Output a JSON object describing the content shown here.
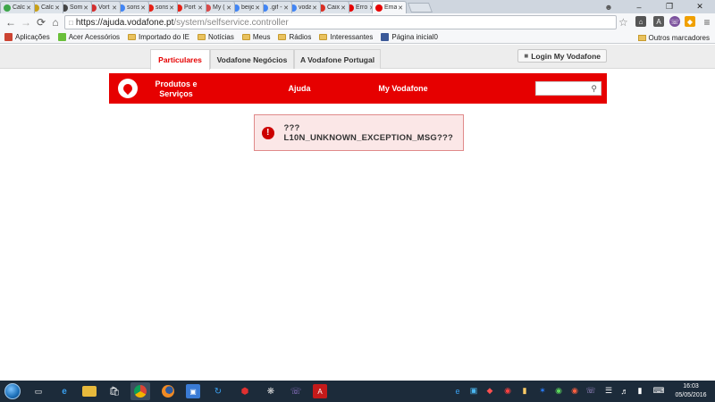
{
  "browser": {
    "tabs": [
      {
        "title": "Calcı",
        "favicon": "green-search-favicon",
        "color": "#3ea64a"
      },
      {
        "title": "Calcı",
        "favicon": "sapo-favicon",
        "color": "#c8a018"
      },
      {
        "title": "Som",
        "favicon": "help-favicon",
        "color": "#444444"
      },
      {
        "title": "Vort",
        "favicon": "y-favicon",
        "color": "#d32f2f"
      },
      {
        "title": "sons",
        "favicon": "google-favicon",
        "color": "#4285f4"
      },
      {
        "title": "sons",
        "favicon": "youtube-favicon",
        "color": "#e62117"
      },
      {
        "title": "Port",
        "favicon": "youtube-favicon",
        "color": "#e62117"
      },
      {
        "title": "My (",
        "favicon": "box-favicon",
        "color": "#d84a4a"
      },
      {
        "title": "beijo",
        "favicon": "google-favicon",
        "color": "#4285f4"
      },
      {
        "title": ".gif -",
        "favicon": "google-favicon",
        "color": "#4285f4"
      },
      {
        "title": "voda",
        "favicon": "google-favicon",
        "color": "#4285f4"
      },
      {
        "title": "Caixa",
        "favicon": "gmail-favicon",
        "color": "#d93025"
      },
      {
        "title": "Erro",
        "favicon": "vodafone-favicon",
        "color": "#e60000"
      },
      {
        "title": "Emai",
        "favicon": "vodafone-favicon",
        "color": "#e60000"
      }
    ],
    "url": {
      "host": "https://ajuda.vodafone.pt",
      "path": "/system/selfservice.controller"
    },
    "bookmarks": [
      {
        "label": "Aplicações",
        "icon": "apps-icon"
      },
      {
        "label": "Acer Acessórios",
        "icon": "acer-icon"
      },
      {
        "label": "Importado do IE",
        "icon": "folder-icon"
      },
      {
        "label": "Notícias",
        "icon": "folder-icon"
      },
      {
        "label": "Meus",
        "icon": "folder-icon"
      },
      {
        "label": "Rádios",
        "icon": "folder-icon"
      },
      {
        "label": "Interessantes",
        "icon": "folder-icon"
      },
      {
        "label": "Página inicial0",
        "icon": "facebook-icon"
      }
    ],
    "other_bookmarks": "Outros marcadores"
  },
  "page": {
    "segments": [
      "Particulares",
      "Vodafone Negócios",
      "A Vodafone Portugal"
    ],
    "login_label": "Login My Vodafone",
    "menu": {
      "products_line1": "Produtos e",
      "products_line2": "Serviços",
      "help": "Ajuda",
      "my_vodafone": "My Vodafone"
    },
    "error": {
      "icon_glyph": "!",
      "message": "???L10N_UNKNOWN_EXCEPTION_MSG???"
    },
    "brand_color": "#e60000"
  },
  "taskbar": {
    "clock_time": "16:03",
    "clock_date": "05/05/2016"
  }
}
